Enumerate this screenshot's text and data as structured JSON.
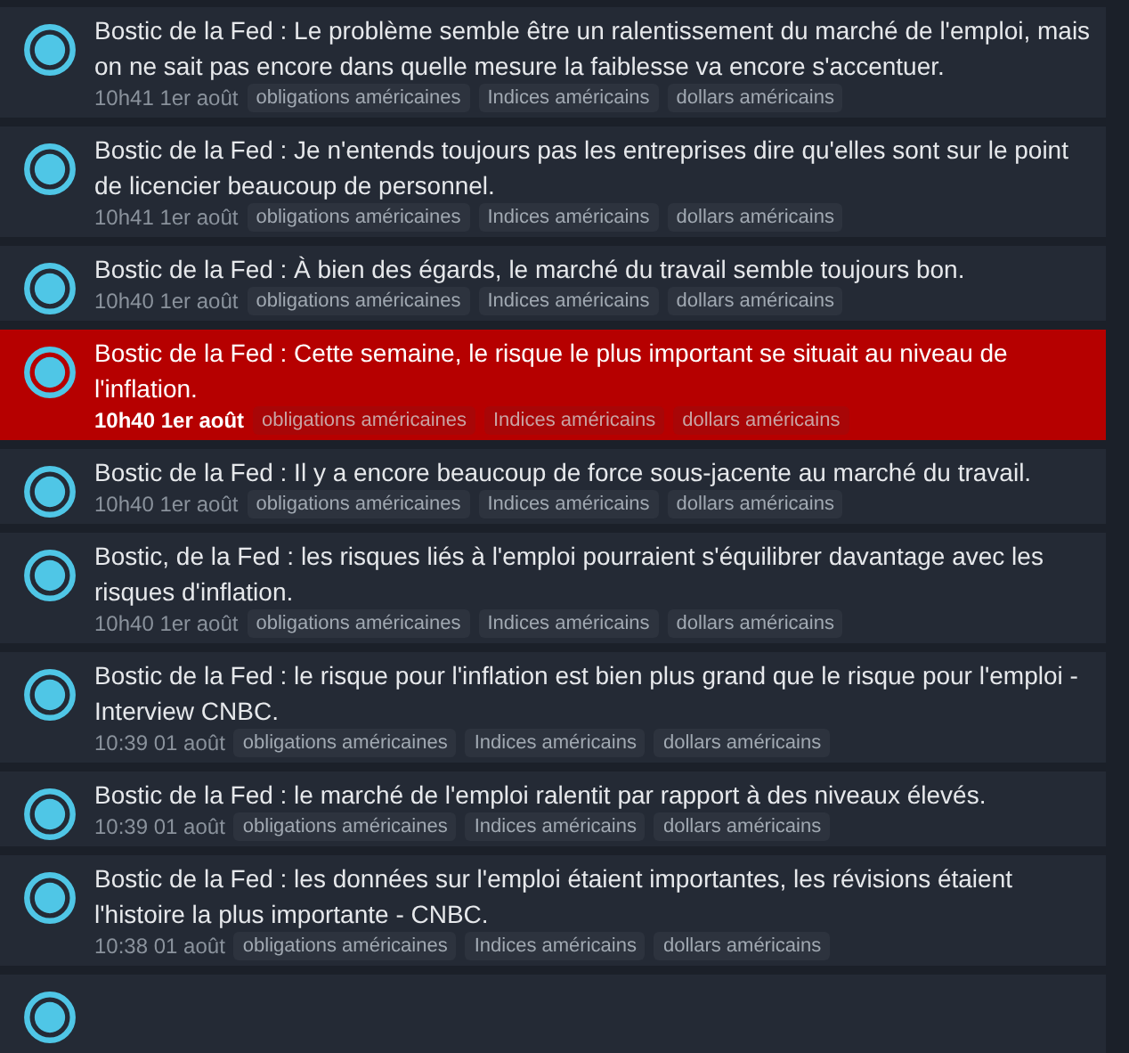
{
  "news": [
    {
      "kind": "item",
      "highlighted": false,
      "text": "Bostic de la Fed : Le problème semble être un ralentissement du marché de l'emploi, mais on ne sait pas encore dans quelle mesure la faiblesse va encore s'accentuer.",
      "time": "10h41 1er août",
      "tags": [
        "obligations américaines",
        "Indices américains",
        "dollars américains"
      ]
    },
    {
      "kind": "item",
      "highlighted": false,
      "text": "Bostic de la Fed : Je n'entends toujours pas les entreprises dire qu'elles sont sur le point de licencier beaucoup de personnel.",
      "time": "10h41 1er août",
      "tags": [
        "obligations américaines",
        "Indices américains",
        "dollars américains"
      ]
    },
    {
      "kind": "item",
      "highlighted": false,
      "text": "Bostic de la Fed : À bien des égards, le marché du travail semble toujours bon.",
      "time": "10h40 1er août",
      "tags": [
        "obligations américaines",
        "Indices américains",
        "dollars américains"
      ]
    },
    {
      "kind": "item",
      "highlighted": true,
      "text": "Bostic de la Fed : Cette semaine, le risque le plus important se situait au niveau de l'inflation.",
      "time": "10h40 1er août",
      "tags": [
        "obligations américaines",
        "Indices américains",
        "dollars américains"
      ]
    },
    {
      "kind": "item",
      "highlighted": false,
      "text": "Bostic de la Fed : Il y a encore beaucoup de force sous-jacente au marché du travail.",
      "time": "10h40 1er août",
      "tags": [
        "obligations américaines",
        "Indices américains",
        "dollars américains"
      ]
    },
    {
      "kind": "item",
      "highlighted": false,
      "text": "Bostic, de la Fed : les risques liés à l'emploi pourraient s'équilibrer davantage avec les risques d'inflation.",
      "time": "10h40 1er août",
      "tags": [
        "obligations américaines",
        "Indices américains",
        "dollars américains"
      ]
    },
    {
      "kind": "item",
      "highlighted": false,
      "text": "Bostic de la Fed : le risque pour l'inflation est bien plus grand que le risque pour l'emploi - Interview CNBC.",
      "time": "10:39 01 août",
      "tags": [
        "obligations américaines",
        "Indices américains",
        "dollars américains"
      ]
    },
    {
      "kind": "item",
      "highlighted": false,
      "text": "Bostic de la Fed : le marché de l'emploi ralentit par rapport à des niveaux élevés.",
      "time": "10:39 01 août",
      "tags": [
        "obligations américaines",
        "Indices américains",
        "dollars américains"
      ]
    },
    {
      "kind": "item",
      "highlighted": false,
      "text": "Bostic de la Fed : les données sur l'emploi étaient importantes, les révisions étaient l'histoire la plus importante - CNBC.",
      "time": "10:38 01 août",
      "tags": [
        "obligations américaines",
        "Indices américains",
        "dollars américains"
      ]
    },
    {
      "kind": "partial"
    }
  ]
}
